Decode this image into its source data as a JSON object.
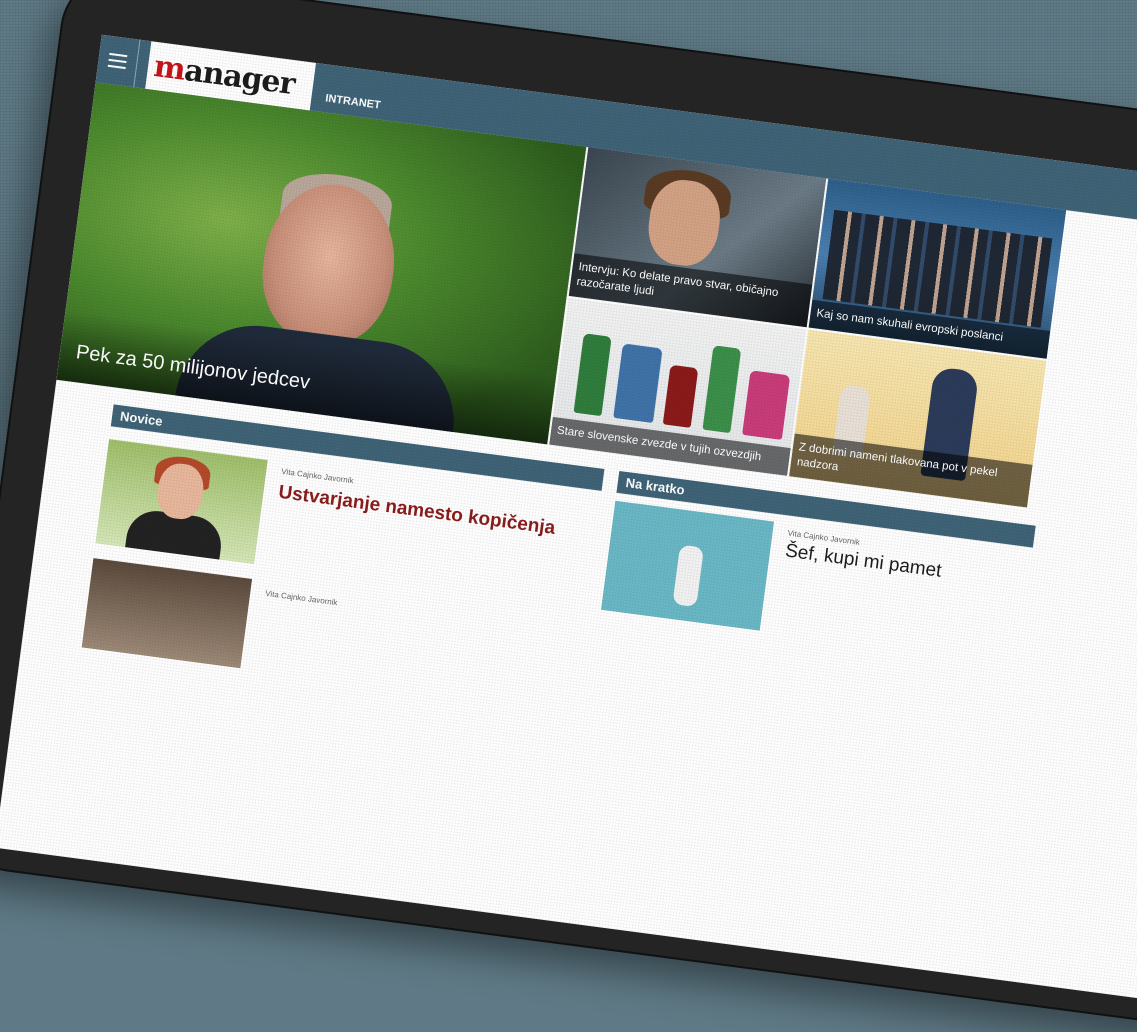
{
  "header": {
    "menu_icon": "hamburger-icon",
    "logo": "manager",
    "logo_m": "m",
    "logo_rest": "anager",
    "section": "INTRANET"
  },
  "hero": {
    "caption": "Pek za 50 milijonov jedcev"
  },
  "tiles": [
    {
      "caption": "Intervju: Ko delate pravo stvar, običajno razočarate ljudi"
    },
    {
      "caption": "Kaj so nam skuhali evropski poslanci"
    },
    {
      "caption": "Stare slovenske zvezde v tujih ozvezdjih"
    },
    {
      "caption": "Z dobrimi nameni tlakovana pot v pekel nadzora"
    }
  ],
  "sections": {
    "novice": "Novice",
    "na_kratko": "Na kratko"
  },
  "articles": [
    {
      "author": "Vita Cajnko Javornik",
      "title": "Ustvarjanje namesto kopičenja"
    },
    {
      "author": "Vita Cajnko Javornik"
    }
  ],
  "kratko": [
    {
      "author": "Vita Cajnko Javornik",
      "title": "Šef, kupi mi pamet"
    }
  ],
  "colors": {
    "header_bg": "#3f6377",
    "logo_red": "#c8141b",
    "headline_red": "#8a1c1c",
    "tablet": "#242424",
    "background": "#5f7a86"
  }
}
